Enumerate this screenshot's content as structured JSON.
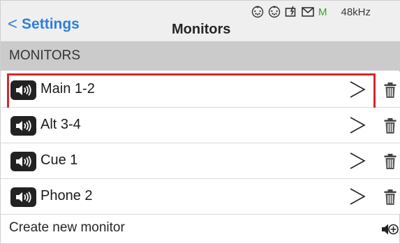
{
  "header": {
    "back_label": "Settings",
    "title": "Monitors",
    "status_icons": [
      "midi-in-icon",
      "midi-out-icon",
      "usb-power-icon",
      "mail-icon"
    ],
    "status_m": "M",
    "sample_rate": "48kHz"
  },
  "section": {
    "title": "MONITORS"
  },
  "monitors": [
    {
      "label": "Main 1-2",
      "selected": true,
      "icon": "speaker-icon"
    },
    {
      "label": "Alt 3-4",
      "selected": false,
      "icon": "speaker-icon"
    },
    {
      "label": "Cue 1",
      "selected": false,
      "icon": "speaker-icon"
    },
    {
      "label": "Phone 2",
      "selected": false,
      "icon": "speaker-icon"
    }
  ],
  "create": {
    "label": "Create new monitor",
    "icon": "add-speaker-icon"
  },
  "colors": {
    "accent": "#2f7fd8",
    "selection": "#d4272e",
    "status_green": "#3aa12e",
    "section_bg": "#cbcbcb",
    "header_bg": "#efefef"
  }
}
